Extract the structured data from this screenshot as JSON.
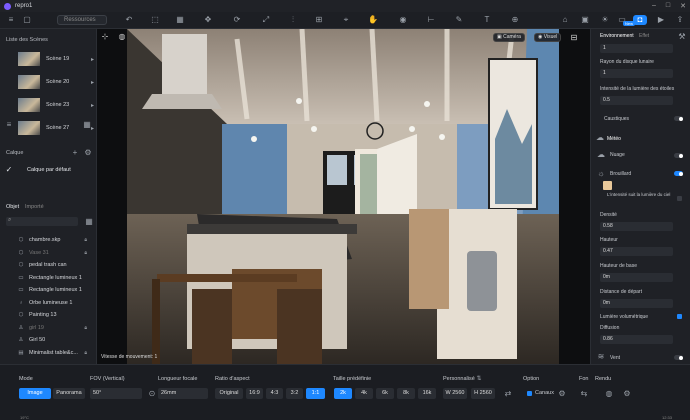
{
  "app": {
    "title": "repro1"
  },
  "toolbar": {
    "search_placeholder": "Ressources",
    "new_badge": "New"
  },
  "left_panel": {
    "scenes_title": "Liste des Scènes",
    "scenes": [
      {
        "name": "Scène 19"
      },
      {
        "name": "Scène 20"
      },
      {
        "name": "Scène 23"
      },
      {
        "name": "Scène 27"
      }
    ],
    "layer_title": "Calque",
    "layer_default": "Calque par défaut",
    "tabs": {
      "object": "Objet",
      "imported": "Importé"
    },
    "objects": [
      {
        "name": "chambre.skp",
        "icon": "box-icon",
        "dim": false
      },
      {
        "name": "Vase 31",
        "icon": "box-icon",
        "dim": true
      },
      {
        "name": "pedal trash can",
        "icon": "box-icon",
        "dim": false
      },
      {
        "name": "Rectangle lumineux 1",
        "icon": "light-rect-icon",
        "dim": false
      },
      {
        "name": "Rectangle lumineux 1",
        "icon": "light-rect-icon",
        "dim": false
      },
      {
        "name": "Orbe lumineuse 1",
        "icon": "bulb-icon",
        "dim": false
      },
      {
        "name": "Painting 13",
        "icon": "box-icon",
        "dim": false
      },
      {
        "name": "girl 19",
        "icon": "person-icon",
        "dim": true
      },
      {
        "name": "Girl 50",
        "icon": "person-icon",
        "dim": false
      },
      {
        "name": "Minimalist table&c...",
        "icon": "folder-icon",
        "dim": false
      }
    ]
  },
  "viewport": {
    "camera_label": "Caméra",
    "visual_label": "Visuel",
    "speed_text": "Vitesse de mouvement: 1"
  },
  "right_panel": {
    "tabs": {
      "environment": "Environnement",
      "effects": "Effet"
    },
    "field_top": "1",
    "moon_radius_label": "Rayon du disque lunaire",
    "moon_radius_value": "1",
    "stars_label": "Intensité de la lumière des étoiles",
    "stars_value": "0.5",
    "caustics_label": "Caustiques",
    "weather_title": "Météo",
    "cloud_label": "Nuage",
    "fog_label": "Brouillard",
    "fog_follow_label": "L'intensité suit la lumière du ciel",
    "density_label": "Densité",
    "density_value": "0.58",
    "height_label": "Hauteur",
    "height_value": "0.47",
    "base_height_label": "Hauteur de base",
    "base_height_value": "0m",
    "start_distance_label": "Distance de départ",
    "start_distance_value": "0m",
    "volumetric_label": "Lumière volumétrique",
    "diffusion_label": "Diffusion",
    "diffusion_value": "0.86",
    "wind_label": "Vent",
    "fog_color": "#e8c89a"
  },
  "bottom": {
    "mode_label": "Mode",
    "mode_image": "Image",
    "mode_panorama": "Panorama",
    "fov_label": "FOV (Vertical)",
    "fov_value": "50°",
    "focal_label": "Longueur focale",
    "focal_value": "26mm",
    "ratio_label": "Ratio d'aspect",
    "ratios": [
      "Original",
      "16:9",
      "4:3",
      "3:2",
      "1:1"
    ],
    "size_label": "Taille prédéfinie",
    "sizes": [
      "2k",
      "4k",
      "6k",
      "8k",
      "16k"
    ],
    "custom_label": "Personnalisé",
    "width_prefix": "W",
    "width_value": "2560",
    "height_prefix": "H",
    "height_value": "2560",
    "option_label": "Option",
    "channels_label": "Canaux",
    "background_label": "Fon",
    "render_label": "Rendu"
  },
  "status": {
    "left": "19°C",
    "right": "12:33"
  }
}
